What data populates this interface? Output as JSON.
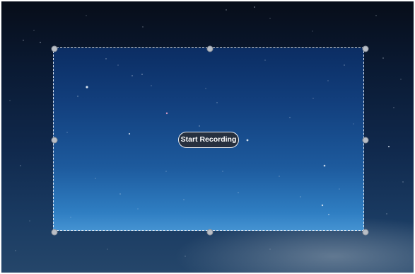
{
  "recording_overlay": {
    "start_label": "Start Recording"
  },
  "colors": {
    "sky_dark": "#070d19",
    "selection_blue": "#1d5a9d",
    "button_bg": "#282e38",
    "handle": "#b9bec6"
  },
  "icons": [
    "resize-handle"
  ]
}
